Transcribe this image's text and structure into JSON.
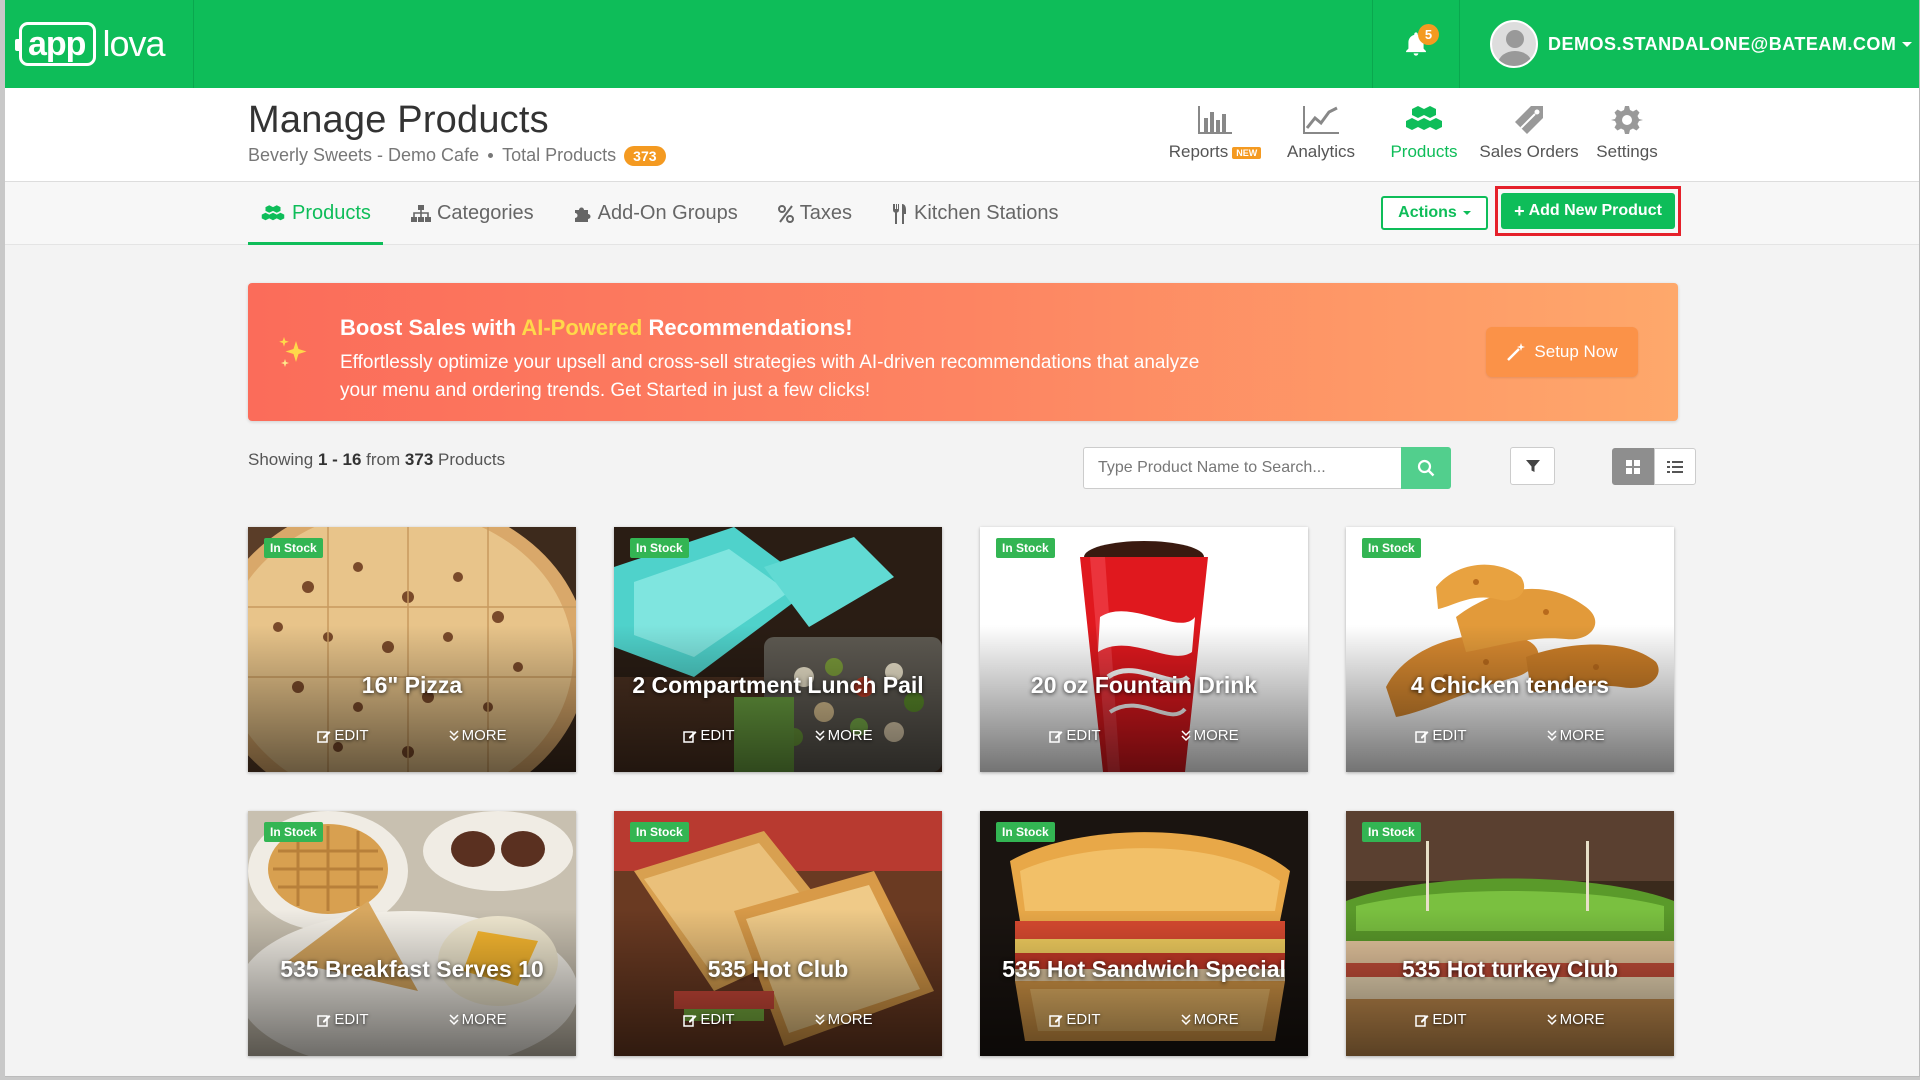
{
  "brand": {
    "logo_boxed": "app",
    "logo_rest": "lova"
  },
  "topbar": {
    "notification_count": "5",
    "user_email": "DEMOS.STANDALONE@BATEAM.COM"
  },
  "header": {
    "title": "Manage Products",
    "store_name": "Beverly Sweets - Demo Cafe",
    "total_label": "Total Products",
    "total_count": "373"
  },
  "topnav": [
    {
      "label": "Reports",
      "icon": "bar-chart-icon",
      "tag": "NEW",
      "active": false
    },
    {
      "label": "Analytics",
      "icon": "line-chart-icon",
      "active": false
    },
    {
      "label": "Products",
      "icon": "cubes-icon",
      "active": true
    },
    {
      "label": "Sales Orders",
      "icon": "tag-icon",
      "active": false
    },
    {
      "label": "Settings",
      "icon": "gear-icon",
      "active": false
    }
  ],
  "tabs": [
    {
      "label": "Products",
      "icon": "cubes-icon",
      "active": true
    },
    {
      "label": "Categories",
      "icon": "sitemap-icon",
      "active": false
    },
    {
      "label": "Add-On Groups",
      "icon": "puzzle-icon",
      "active": false
    },
    {
      "label": "Taxes",
      "icon": "percent-icon",
      "active": false
    },
    {
      "label": "Kitchen Stations",
      "icon": "utensils-icon",
      "active": false
    }
  ],
  "toolbar": {
    "actions_label": "Actions",
    "add_label": "Add New Product"
  },
  "banner": {
    "title_before": "Boost Sales with ",
    "title_highlight": "AI-Powered",
    "title_after": " Recommendations!",
    "text": "Effortlessly optimize your upsell and cross-sell strategies with AI-driven recommendations that analyze your menu and ordering trends. Get Started in just a few clicks!",
    "button_label": "Setup Now"
  },
  "listing": {
    "showing_prefix": "Showing",
    "range": "1 - 16",
    "from_word": "from",
    "total": "373",
    "suffix": "Products",
    "search_placeholder": "Type Product Name to Search..."
  },
  "card_labels": {
    "stock": "In Stock",
    "edit": "EDIT",
    "more": "MORE"
  },
  "products": [
    {
      "name": "16\" Pizza",
      "image": "pizza"
    },
    {
      "name": "2 Compartment Lunch Pail",
      "image": "lunch-pail"
    },
    {
      "name": "20 oz Fountain Drink",
      "image": "fountain-drink"
    },
    {
      "name": "4 Chicken tenders",
      "image": "chicken-tenders"
    },
    {
      "name": "535 Breakfast Serves 10",
      "image": "breakfast"
    },
    {
      "name": "535 Hot Club",
      "image": "hot-club"
    },
    {
      "name": "535 Hot Sandwich Special",
      "image": "hot-sandwich"
    },
    {
      "name": "535 Hot turkey Club",
      "image": "turkey-club"
    }
  ],
  "colors": {
    "brand_green": "#0ebd59",
    "accent_orange": "#f49a21",
    "highlight_red": "#e5202a"
  }
}
